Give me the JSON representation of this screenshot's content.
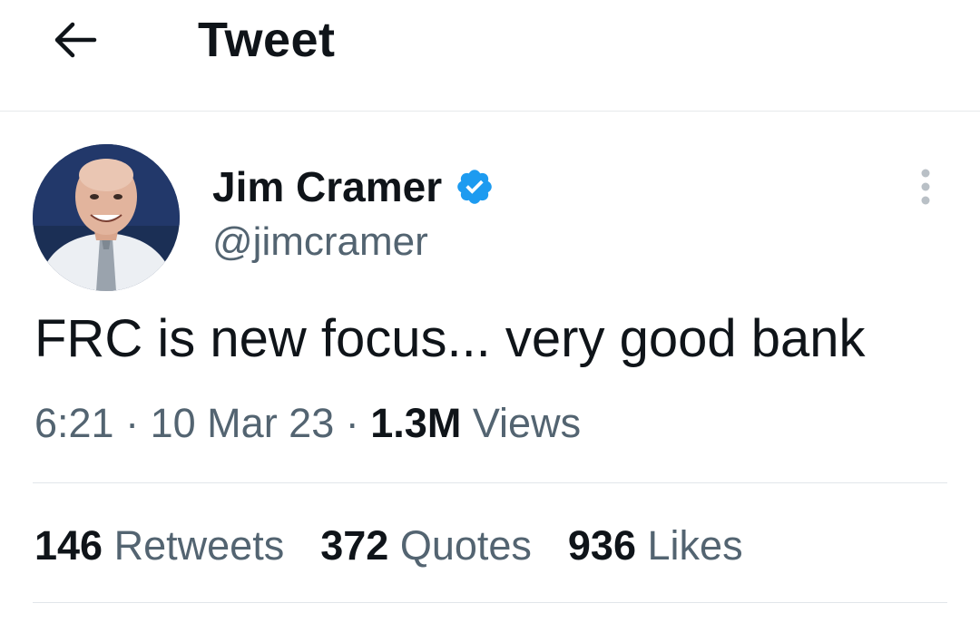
{
  "header": {
    "back_icon": "arrow-left-icon",
    "title": "Tweet"
  },
  "author": {
    "display_name": "Jim Cramer",
    "handle": "@jimcramer",
    "verified_icon": "verified-badge-icon",
    "verified_color": "#1d9bf0"
  },
  "tweet": {
    "text": "FRC is new focus... very good bank",
    "time": "6:21",
    "separator": "·",
    "date": "10 Mar 23",
    "views_count": "1.3M",
    "views_label": "Views"
  },
  "stats": [
    {
      "count": "146",
      "label": "Retweets"
    },
    {
      "count": "372",
      "label": "Quotes"
    },
    {
      "count": "936",
      "label": "Likes"
    }
  ],
  "more_icon": "more-vertical-icon",
  "colors": {
    "text_primary": "#0f1419",
    "text_secondary": "#536471",
    "divider": "#e1e6ea"
  }
}
